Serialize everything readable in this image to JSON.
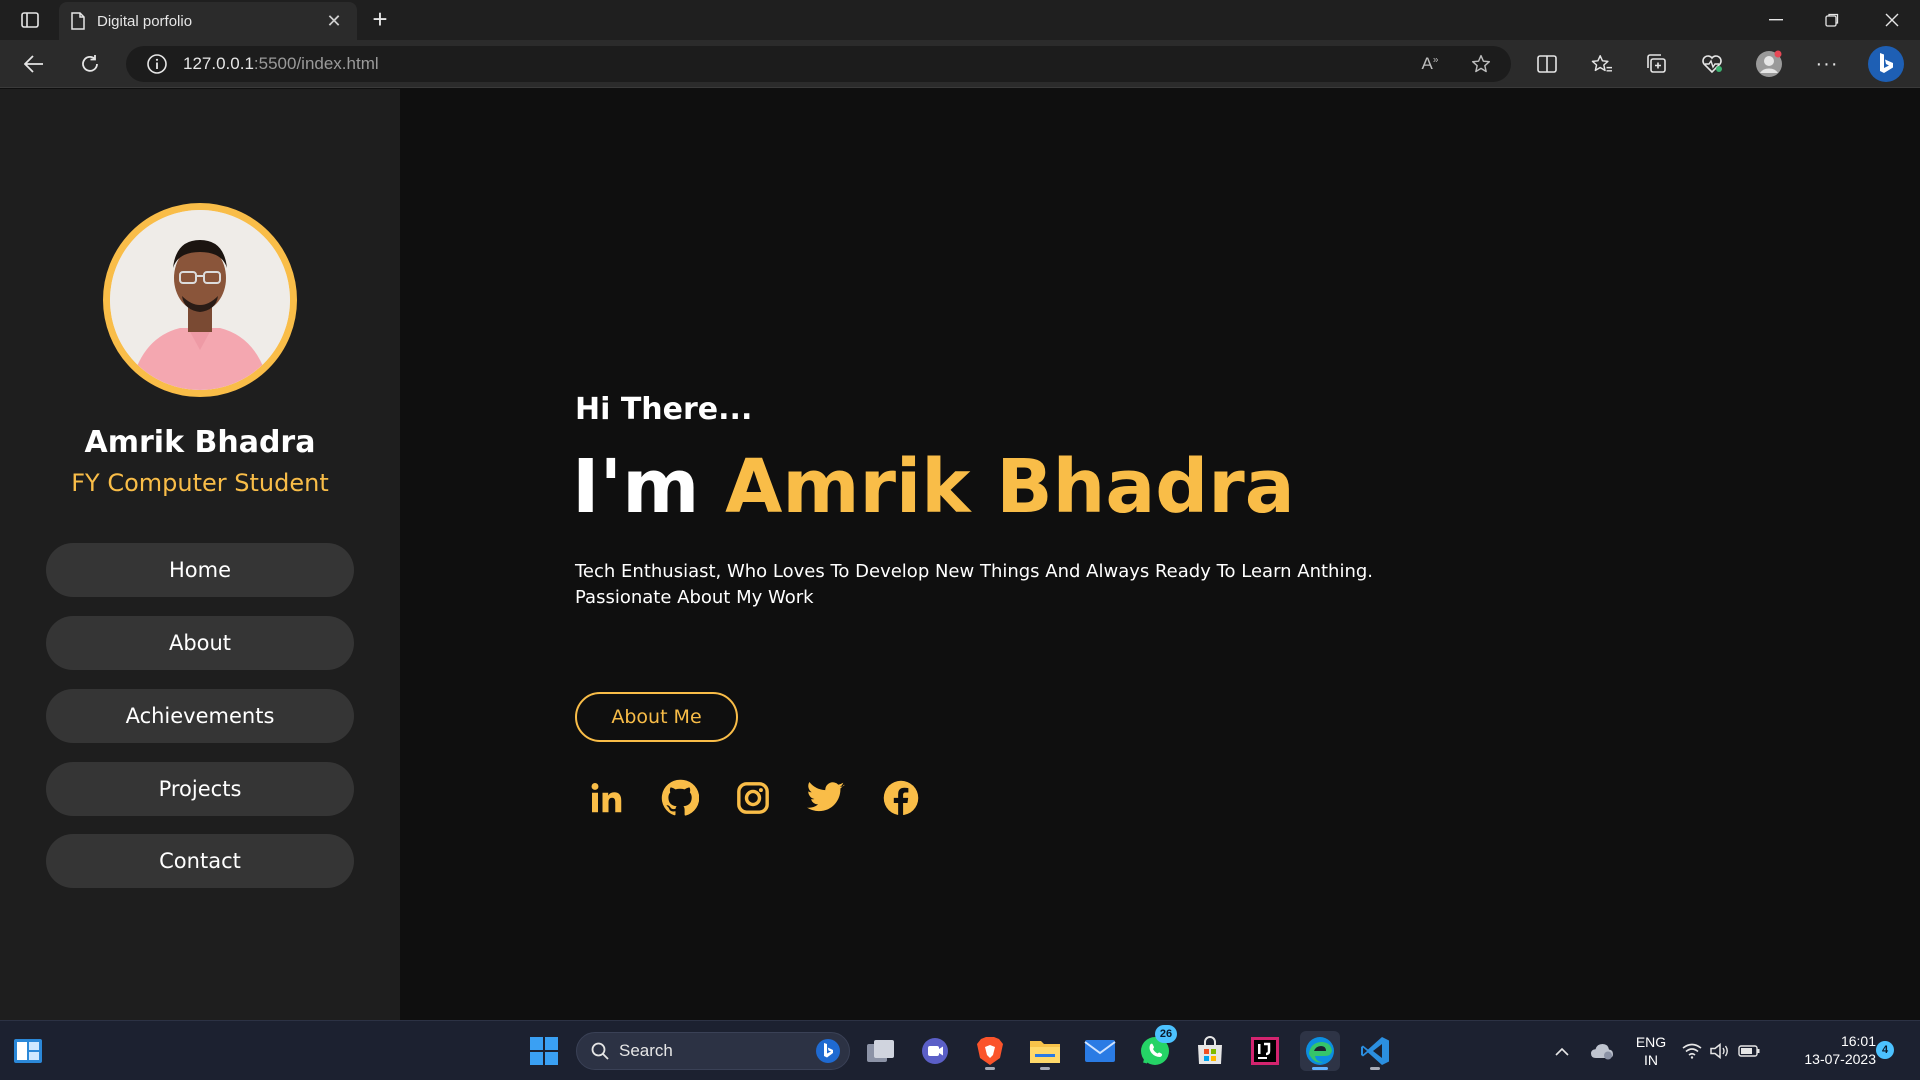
{
  "browser": {
    "tab_title": "Digital porfolio",
    "url_host": "127.0.0.1",
    "url_rest": ":5500/index.html"
  },
  "profile": {
    "name": "Amrik Bhadra",
    "role": "FY Computer Student"
  },
  "nav": [
    {
      "label": "Home"
    },
    {
      "label": "About"
    },
    {
      "label": "Achievements"
    },
    {
      "label": "Projects"
    },
    {
      "label": "Contact"
    }
  ],
  "hero": {
    "greeting": "Hi There...",
    "im": "I'm ",
    "name": "Amrik Bhadra",
    "bio": "Tech Enthusiast, Who Loves To Develop New Things And Always Ready To Learn Anthing. Passionate About My Work",
    "cta": "About Me"
  },
  "social_icons": [
    "linkedin-icon",
    "github-icon",
    "instagram-icon",
    "twitter-icon",
    "facebook-icon"
  ],
  "taskbar": {
    "search_label": "Search",
    "whatsapp_badge": "26",
    "language_top": "ENG",
    "language_bottom": "IN",
    "time": "16:01",
    "date": "13-07-2023",
    "notification_count": "4"
  },
  "colors": {
    "accent": "#f9bd48",
    "sidebar_bg": "#1e1e1e",
    "page_bg": "#0f0f0f",
    "nav_button_bg": "#353535"
  }
}
